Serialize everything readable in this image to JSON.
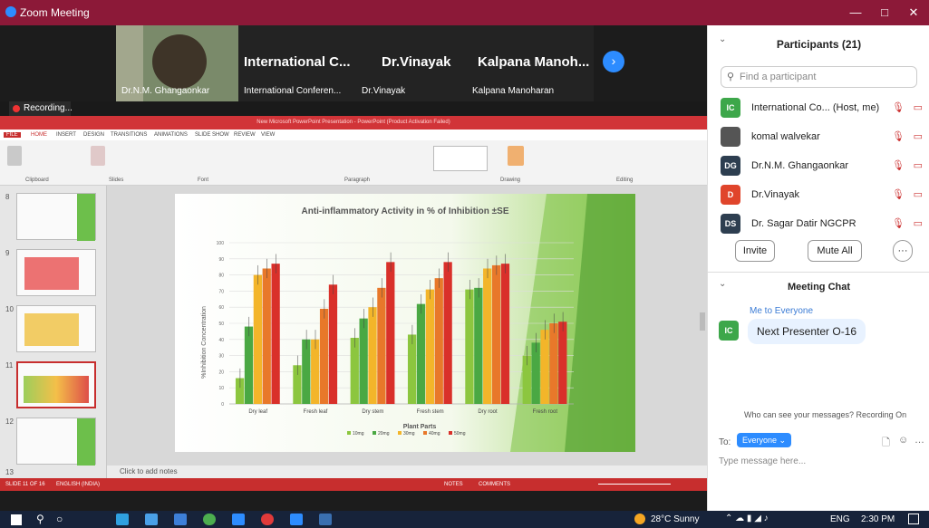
{
  "window": {
    "title": "Zoom Meeting"
  },
  "video_tiles": [
    {
      "name": "Dr.N.M. Ghangaonkar",
      "big_label": ""
    },
    {
      "name": "International Conferen...",
      "big_label": "International C..."
    },
    {
      "name": "Dr.Vinayak",
      "big_label": "Dr.Vinayak"
    },
    {
      "name": "Kalpana Manoharan",
      "big_label": "Kalpana Manoh..."
    }
  ],
  "recording_label": "Recording...",
  "ppt": {
    "title": "New Microsoft PowerPoint Presentation - PowerPoint (Product Activation Failed)",
    "tabs": [
      "FILE",
      "HOME",
      "INSERT",
      "DESIGN",
      "TRANSITIONS",
      "ANIMATIONS",
      "SLIDE SHOW",
      "REVIEW",
      "VIEW"
    ],
    "groups": [
      "Clipboard",
      "Slides",
      "Font",
      "Paragraph",
      "Drawing",
      "Editing"
    ],
    "thumb_numbers": [
      "8",
      "9",
      "10",
      "11",
      "12",
      "13"
    ],
    "notes_placeholder": "Click to add notes",
    "status_left": "SLIDE 11 OF 16",
    "status_lang": "ENGLISH (INDIA)",
    "status_notes": "NOTES",
    "status_comments": "COMMENTS"
  },
  "chart_data": {
    "type": "bar",
    "title": "Anti-inflammatory Activity in % of Inhibition ±SE",
    "xlabel": "Plant Parts",
    "ylabel": "%Inhibition Concentration",
    "ylim": [
      0,
      100
    ],
    "yticks": [
      "0",
      "10",
      "20",
      "30",
      "40",
      "50",
      "60",
      "70",
      "80",
      "90",
      "100"
    ],
    "categories": [
      "Dry leaf",
      "Fresh leaf",
      "Dry stem",
      "Fresh stem",
      "Dry root",
      "Fresh root"
    ],
    "series": [
      {
        "name": "10mg",
        "color": "#8cc63f",
        "values": [
          16,
          24,
          41,
          43,
          71,
          30
        ]
      },
      {
        "name": "20mg",
        "color": "#4aa843",
        "values": [
          48,
          40,
          53,
          62,
          72,
          38
        ]
      },
      {
        "name": "30mg",
        "color": "#f3b52a",
        "values": [
          80,
          40,
          60,
          71,
          84,
          46
        ]
      },
      {
        "name": "40mg",
        "color": "#e8782a",
        "values": [
          84,
          59,
          72,
          78,
          86,
          50
        ]
      },
      {
        "name": "50mg",
        "color": "#d9302a",
        "values": [
          87,
          74,
          88,
          88,
          87,
          51
        ]
      }
    ],
    "legend_position": "bottom"
  },
  "panel": {
    "participants_title": "Participants (21)",
    "search_placeholder": "Find a participant",
    "participants": [
      {
        "initials": "IC",
        "name": "International Co... (Host, me)",
        "color": "#3da74a"
      },
      {
        "initials": "",
        "name": "komal walvekar",
        "color": "#555"
      },
      {
        "initials": "DG",
        "name": "Dr.N.M. Ghangaonkar",
        "color": "#2d3e50"
      },
      {
        "initials": "D",
        "name": "Dr.Vinayak",
        "color": "#e0452b"
      },
      {
        "initials": "DS",
        "name": "Dr. Sagar Datir NGCPR",
        "color": "#2d3e50"
      }
    ],
    "invite": "Invite",
    "mute_all": "Mute All",
    "more": "···",
    "chat_title": "Meeting Chat",
    "chat_meta": "Me to Everyone",
    "chat_msg": "Next Presenter O-16",
    "chat_initials": "IC",
    "who_can_see": "Who can see your messages? Recording On",
    "to_label": "To:",
    "to_value": "Everyone",
    "input_placeholder": "Type message here..."
  },
  "taskbar": {
    "weather": "28°C Sunny",
    "lang": "ENG",
    "time": "2:30 PM"
  }
}
